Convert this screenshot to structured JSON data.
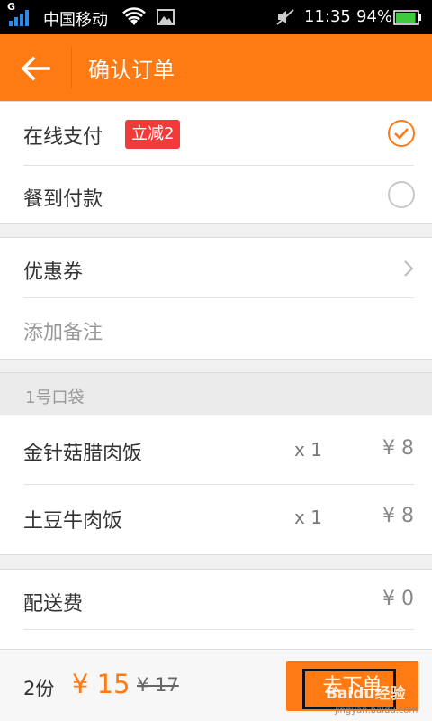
{
  "status_bar": {
    "g_label": "G",
    "carrier": "中国移动",
    "time": "11:35",
    "battery": "94%",
    "battery_level": 0.94
  },
  "header": {
    "title": "确认订单",
    "back_icon": "arrow-left-icon"
  },
  "payment": {
    "online_label": "在线支付",
    "online_badge": "立减2",
    "online_selected": true,
    "cod_label": "餐到付款",
    "cod_selected": false
  },
  "extras": {
    "coupon_label": "优惠券",
    "note_label": "添加备注"
  },
  "bag": {
    "title": "1号口袋",
    "items": [
      {
        "name": "金针菇腊肉饭",
        "qty": "x 1",
        "price": "¥ 8"
      },
      {
        "name": "土豆牛肉饭",
        "qty": "x 1",
        "price": "¥ 8"
      }
    ]
  },
  "fees": {
    "delivery_label": "配送费",
    "delivery_price": "¥ 0"
  },
  "footer": {
    "count": "2份",
    "total": "¥ 15",
    "original": "¥ 17",
    "submit_label": "去下单",
    "watermark": "Baidu经验",
    "watermark_sub": "jingyan.baidu.com"
  },
  "colors": {
    "accent": "#ff7a13",
    "badge": "#f23a3a",
    "background": "#f0f0f0"
  }
}
